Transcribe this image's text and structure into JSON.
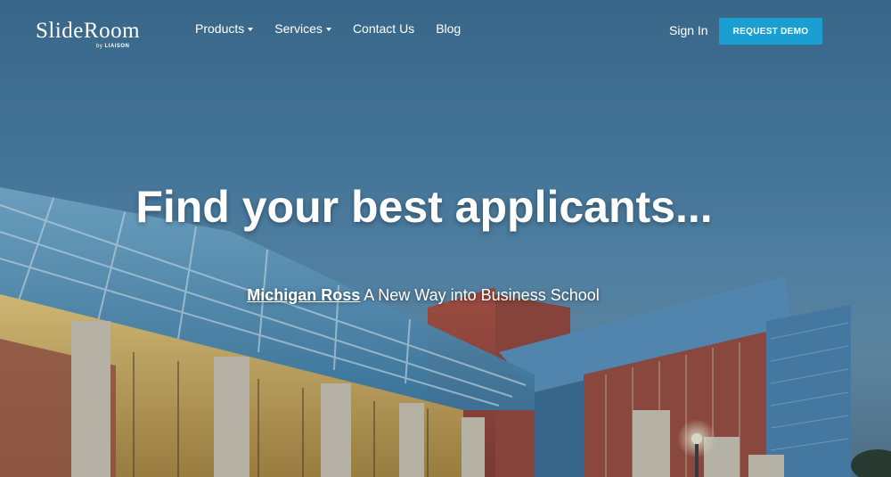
{
  "logo": {
    "main": "SlideRoom",
    "by": "by",
    "brand": "LIAISON"
  },
  "nav": {
    "items": [
      {
        "label": "Products",
        "has_dropdown": true
      },
      {
        "label": "Services",
        "has_dropdown": true
      },
      {
        "label": "Contact Us",
        "has_dropdown": false
      },
      {
        "label": "Blog",
        "has_dropdown": false
      }
    ],
    "sign_in": "Sign In",
    "request_demo": "REQUEST DEMO"
  },
  "hero": {
    "title": "Find your best applicants...",
    "link_text": "Michigan Ross",
    "subtitle": "A New Way into Business School"
  },
  "colors": {
    "accent": "#1b9fd2",
    "sky": "#4a7ea4",
    "building_red": "#a5473a"
  }
}
